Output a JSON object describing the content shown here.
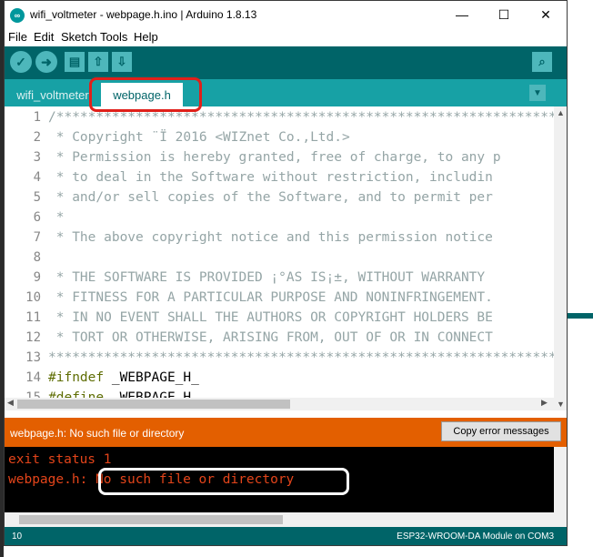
{
  "window": {
    "title": "wifi_voltmeter - webpage.h.ino | Arduino 1.8.13",
    "minimize_glyph": "—",
    "maximize_glyph": "☐",
    "close_glyph": "✕"
  },
  "menu": [
    "File",
    "Edit",
    "Sketch",
    "Tools",
    "Help"
  ],
  "toolbar": {
    "buttons": [
      "verify-icon",
      "upload-icon",
      "new-icon",
      "open-icon",
      "save-icon",
      "serial-monitor-icon"
    ]
  },
  "tabs": [
    {
      "label": "wifi_voltmeter",
      "active": false
    },
    {
      "label": "webpage.h",
      "active": true
    }
  ],
  "editor": {
    "lines": [
      {
        "n": "1",
        "text": "/*****************************************************************"
      },
      {
        "n": "2",
        "text": " * Copyright ¨Ï 2016 <WIZnet Co.,Ltd.>"
      },
      {
        "n": "3",
        "text": " * Permission is hereby granted, free of charge, to any p"
      },
      {
        "n": "4",
        "text": " * to deal in the Software without restriction, includin"
      },
      {
        "n": "5",
        "text": " * and/or sell copies of the Software, and to permit per"
      },
      {
        "n": "6",
        "text": " *"
      },
      {
        "n": "7",
        "text": " * The above copyright notice and this permission notice"
      },
      {
        "n": "8",
        "text": ""
      },
      {
        "n": "9",
        "text": " * THE SOFTWARE IS PROVIDED ¡°AS IS¡±, WITHOUT WARRANTY"
      },
      {
        "n": "10",
        "text": " * FITNESS FOR A PARTICULAR PURPOSE AND NONINFRINGEMENT."
      },
      {
        "n": "11",
        "text": " * IN NO EVENT SHALL THE AUTHORS OR COPYRIGHT HOLDERS BE"
      },
      {
        "n": "12",
        "text": " * TORT OR OTHERWISE, ARISING FROM, OUT OF OR IN CONNECT"
      },
      {
        "n": "13",
        "text": "*****************************************************************"
      },
      {
        "n": "14",
        "directive": "#ifndef",
        "text": " _WEBPAGE_H_"
      },
      {
        "n": "15",
        "directive": "#define",
        "text": " _WEBPAGE_H_"
      }
    ]
  },
  "status": {
    "message": "webpage.h: No such file or directory",
    "copy_button": "Copy error messages"
  },
  "console": {
    "line1": "exit status 1",
    "line2_prefix": "webpage.h:",
    "line2_error": " No such file or directory"
  },
  "footer": {
    "line_number": "10",
    "board": "ESP32-WROOM-DA Module on COM3"
  },
  "colors": {
    "toolbar": "#006468",
    "tabbar": "#17a1a5",
    "error_bar": "#e35f00",
    "console_text": "#e3441a",
    "highlight_red": "#e0201a"
  }
}
